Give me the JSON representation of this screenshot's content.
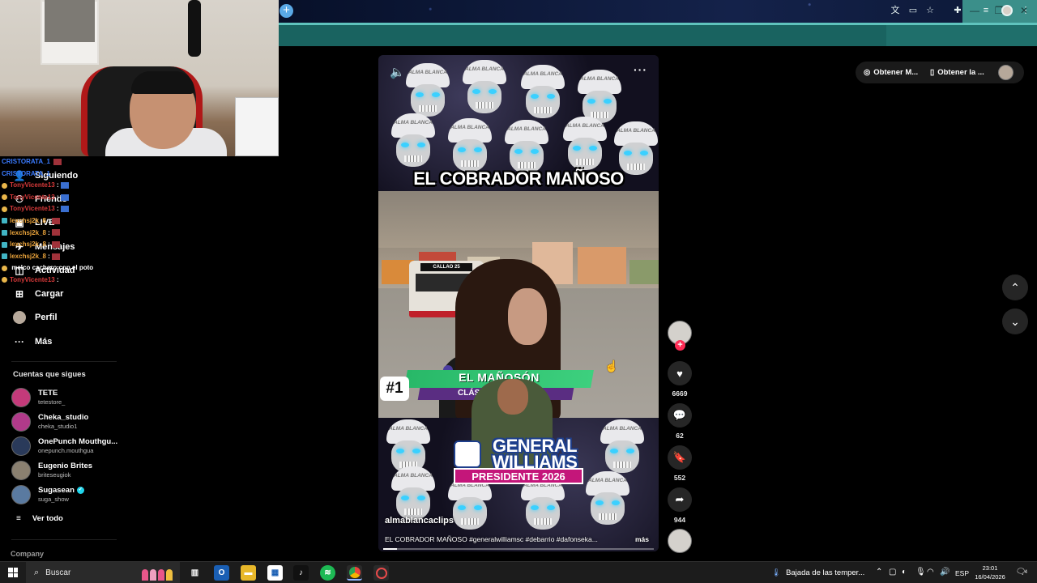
{
  "browser": {
    "new_tab_icon": "+",
    "window_controls": {
      "minimize": "—",
      "restore": "❐",
      "close": "✕"
    },
    "toolbar_icons": [
      "translate-icon",
      "cast-icon",
      "star-icon",
      "extensions-icon",
      "media-icon",
      "profile-icon",
      "menu-icon"
    ]
  },
  "chat": [
    {
      "user": "CRISTORATA_1",
      "color": "#3a7bff",
      "badge": "none",
      "msg": "",
      "emote": "red"
    },
    {
      "user": "CRISTORATA_1",
      "color": "#3a7bff",
      "badge": "none",
      "msg": "",
      "emote": "none"
    },
    {
      "user": "TonyVicente13",
      "color": "#d83a3a",
      "badge": "sub",
      "msg": ":",
      "emote": "blue"
    },
    {
      "user": "TonyVicente13",
      "color": "#d83a3a",
      "badge": "sub",
      "msg": ":",
      "emote": "blue"
    },
    {
      "user": "TonyVicente13",
      "color": "#d83a3a",
      "badge": "sub",
      "msg": ":",
      "emote": "blue"
    },
    {
      "user": "lexchsj2k_8",
      "color": "#e8a23a",
      "badge": "mod",
      "msg": ":",
      "emote": "red"
    },
    {
      "user": "lexchsj2k_8",
      "color": "#e8a23a",
      "badge": "mod",
      "msg": ":",
      "emote": "red"
    },
    {
      "user": "lexchsj2k_8",
      "color": "#e8a23a",
      "badge": "mod",
      "msg": ":",
      "emote": "red"
    },
    {
      "user": "lexchsj2k_8",
      "color": "#e8a23a",
      "badge": "mod",
      "msg": ":",
      "emote": "red"
    },
    {
      "user": "",
      "color": "#e8a23a",
      "badge": "sub",
      "msg": "melco cachero con el poto",
      "emote": "none"
    },
    {
      "user": "TonyVicente13",
      "color": "#d83a3a",
      "badge": "sub",
      "msg": ":",
      "emote": "none"
    }
  ],
  "sidebar": {
    "nav": [
      {
        "label": "Siguiendo",
        "icon": "following-icon"
      },
      {
        "label": "Friends",
        "icon": "friends-icon"
      },
      {
        "label": "LIVE",
        "icon": "live-icon"
      },
      {
        "label": "Mensajes",
        "icon": "messages-icon"
      },
      {
        "label": "Actividad",
        "icon": "activity-icon"
      },
      {
        "label": "Cargar",
        "icon": "upload-icon"
      },
      {
        "label": "Perfil",
        "icon": "profile-icon"
      },
      {
        "label": "Más",
        "icon": "more-icon"
      }
    ],
    "following_title": "Cuentas que sigues",
    "following": [
      {
        "name": "TETE",
        "handle": "tetestore_",
        "verified": false,
        "color": "#c43a7a"
      },
      {
        "name": "Cheka_studio",
        "handle": "cheka_studio1",
        "verified": false,
        "color": "#b13a8a"
      },
      {
        "name": "OnePunch Mouthgu...",
        "handle": "onepunch.mouthgua",
        "verified": false,
        "color": "#2a3a5a"
      },
      {
        "name": "Eugenio Brites",
        "handle": "briteseugiok",
        "verified": false,
        "color": "#8a8070"
      },
      {
        "name": "Sugasean",
        "handle": "suga_show",
        "verified": true,
        "color": "#5a7aa0"
      }
    ],
    "see_all": "Ver todo",
    "company": "Company"
  },
  "top_actions": {
    "get_app_1": "Obtener M...",
    "get_app_2": "Obtener la ..."
  },
  "video": {
    "title_text": "EL COBRADOR MAÑOSO",
    "cap_text": "ALMA BLANCA",
    "rank": "#1",
    "banner": "EL MAÑOSÓN",
    "banner_sub": "CLÁSICAS DE CO...",
    "bus_sign": "CALLAO 25",
    "general_name_1": "GENERAL",
    "general_name_2": "WILLIAMS",
    "general_tagline": "PRESIDENTE 2026",
    "author": "almablancaclips",
    "caption": "EL COBRADOR MAÑOSO #generalwilliamsc #debarrio #dafonseka...",
    "more_label": "más",
    "progress": 0.05
  },
  "actions": {
    "likes": "6669",
    "comments": "62",
    "saves": "552",
    "shares": "944"
  },
  "taskbar": {
    "search_placeholder": "Buscar",
    "weather": "Bajada de las temper...",
    "lang": "ESP",
    "time": "23:01",
    "date": "16/04/2026",
    "notif_count": "4"
  }
}
